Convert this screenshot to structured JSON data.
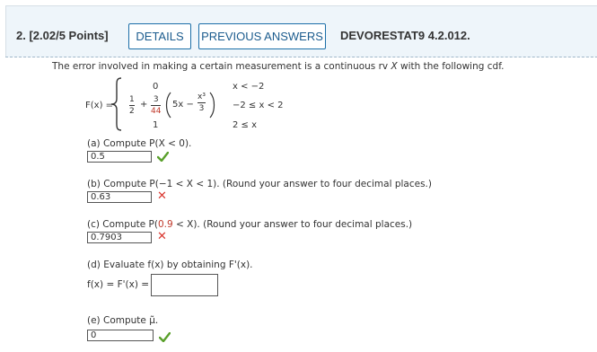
{
  "header": {
    "question_label": "2. [2.02/5 Points]",
    "details_label": "DETAILS",
    "previous_answers_label": "PREVIOUS ANSWERS",
    "source_code": "DEVORESTAT9 4.2.012."
  },
  "intro": {
    "before": "The error involved in making a certain measurement is a continuous rv ",
    "var": "X",
    "after": " with the following cdf."
  },
  "cdf": {
    "label": "F(x) =",
    "row1_value": "0",
    "row1_condition": "x < −2",
    "half_num": "1",
    "half_den": "2",
    "plus": "+",
    "coef_num": "3",
    "coef_den": "44",
    "inner_expr": "5x −",
    "cube_num": "x³",
    "cube_den": "3",
    "row2_condition": "−2 ≤ x < 2",
    "row3_value": "1",
    "row3_condition": "2 ≤ x"
  },
  "parts": {
    "a": {
      "prompt": "(a) Compute P(X < 0).",
      "answer": "0.5",
      "status": "correct"
    },
    "b": {
      "prompt": "(b) Compute P(−1 < X < 1). (Round your answer to four decimal places.)",
      "answer": "0.63",
      "status": "incorrect"
    },
    "c": {
      "prompt_before": "(c) Compute P(",
      "highlight": "0.9",
      "prompt_after": " < X). (Round your answer to four decimal places.)",
      "answer": "0.7903",
      "status": "incorrect"
    },
    "d": {
      "prompt": "(d) Evaluate f(x) by obtaining F'(x).",
      "equation": "f(x) = F'(x) =",
      "answer": ""
    },
    "e": {
      "prompt": "(e) Compute μ̃.",
      "answer": "0",
      "status": "correct"
    }
  },
  "colors": {
    "accent": "#1c6fa8",
    "correct": "#5aa02c",
    "incorrect": "#d9372f",
    "highlight": "#c0392b"
  },
  "icons": {
    "correct": "check-icon",
    "incorrect": "x-icon"
  }
}
